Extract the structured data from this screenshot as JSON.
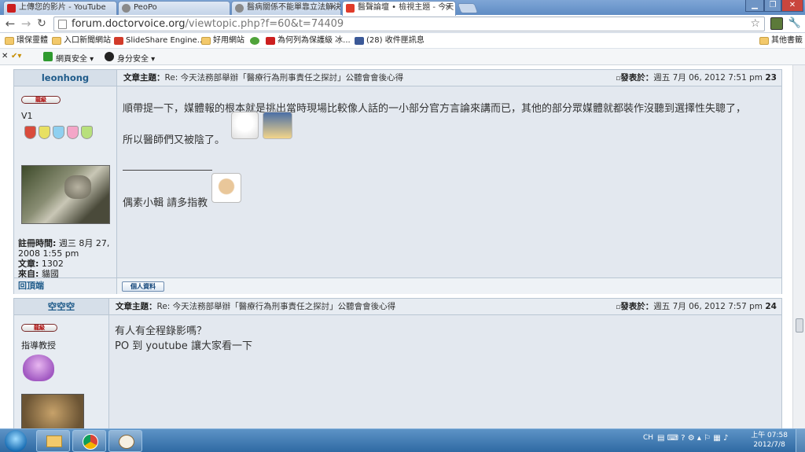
{
  "browser": {
    "tabs": [
      {
        "title": "上傳您的影片 - YouTube",
        "favicon_color": "#cc1f1f"
      },
      {
        "title": "PeoPo",
        "favicon_color": "#8a8a8a"
      },
      {
        "title": "醫病關係不能單靠立法解決",
        "favicon_color": "#8a8a8a"
      },
      {
        "title": "醫聲論壇 • 檢視主題 - 今天",
        "favicon_color": "#e03b2a"
      }
    ],
    "window_controls": [
      "minimize",
      "restore",
      "close"
    ],
    "url_host": "forum.doctorvoice.org",
    "url_path": "/viewtopic.php?f=60&t=74409",
    "bookmarks": [
      {
        "label": "環保靈體",
        "icon": "folder-icon"
      },
      {
        "label": "入口新聞網站",
        "icon": "folder-icon"
      },
      {
        "label": "SlideShare Engine...",
        "icon": "slideshare-icon"
      },
      {
        "label": "好用網站",
        "icon": "folder-icon"
      },
      {
        "label": "",
        "icon": "green-leaf-icon"
      },
      {
        "label": "為何列為保護級 冰...",
        "icon": "youtube-icon"
      },
      {
        "label": "(28) 收件匣訊息",
        "icon": "facebook-icon"
      }
    ],
    "other_bookmarks": "其他書籤",
    "addons": [
      {
        "label": "網頁安全",
        "icon": "ok-icon"
      },
      {
        "label": "身分安全",
        "icon": "id-icon"
      }
    ]
  },
  "posts": [
    {
      "author": "leonhong",
      "badge": "龍級",
      "rank": "V1",
      "shield_colors": [
        "#d94b3c",
        "#e8e062",
        "#8fd0f0",
        "#f4a6c8",
        "#b8e07c"
      ],
      "stats": {
        "joined_label": "註冊時間:",
        "joined": "週三 8月 27, 2008 1:55 pm",
        "posts_label": "文章:",
        "posts": "1302",
        "from_label": "來自:",
        "from": "貓國"
      },
      "subject_label": "文章主題：",
      "subject": "Re: 今天法務部舉辦「醫療行為刑事責任之探討」公聽會會後心得",
      "posted_label": "發表於：",
      "posted": "週五 7月 06, 2012 7:51 pm",
      "post_no": "23",
      "body_lines": [
        "順帶提一下，媒體報的根本就是挑出當時現場比較像人話的一小部分官方言論來講而已，其他的部分眾媒體就都裝作沒聽到選擇性失聰了，",
        "所以醫師們又被陰了。"
      ],
      "signature": "偶素小輯 請多指教",
      "back_to_top": "回頂端",
      "profile_button": "個人資料"
    },
    {
      "author": "空空空",
      "badge": "龍級",
      "rank": "指導教授",
      "subject_label": "文章主題：",
      "subject": "Re: 今天法務部舉辦「醫療行為刑事責任之探討」公聽會會後心得",
      "posted_label": "發表於：",
      "posted": "週五 7月 06, 2012 7:57 pm",
      "post_no": "24",
      "body_lines": [
        "有人有全程錄影嗎？",
        "PO 到 youtube 讓大家看一下"
      ]
    }
  ],
  "taskbar": {
    "apps": [
      "explorer-icon",
      "chrome-icon",
      "paint-icon"
    ],
    "lang": "CH",
    "time": "上午 07:58",
    "date": "2012/7/8"
  },
  "colors": {
    "link_blue": "#1f5b8a",
    "post_bg": "#e3e8ef",
    "header_bg": "#d6dfe9"
  }
}
